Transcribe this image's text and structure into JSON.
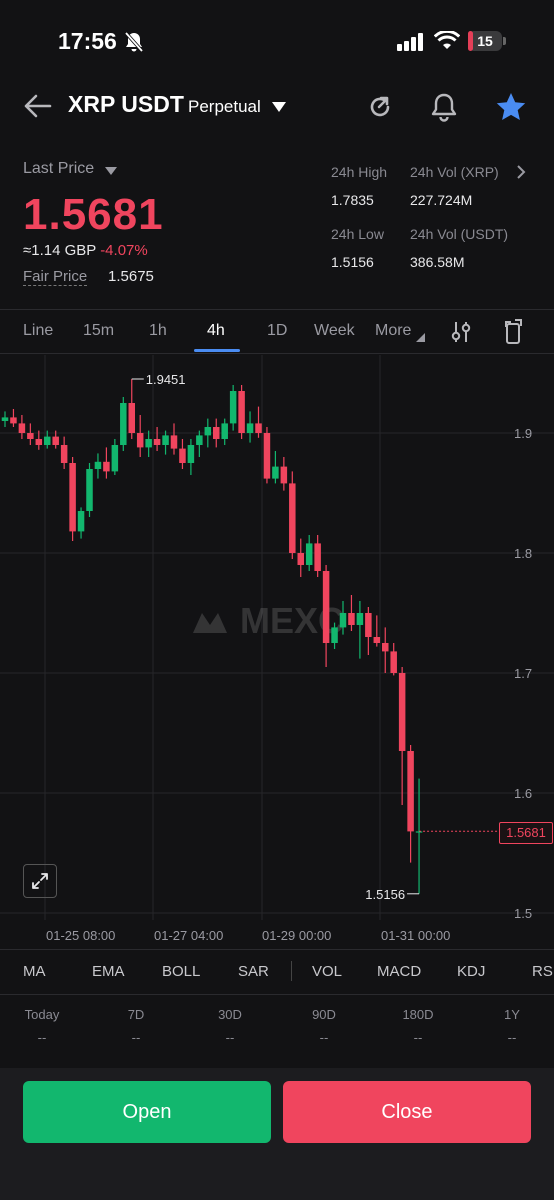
{
  "status": {
    "time": "17:56",
    "battery": "15",
    "battery_level": 0.15
  },
  "header": {
    "symbol": "XRP USDT",
    "contract": "Perpetual"
  },
  "price": {
    "last_price_label": "Last Price",
    "last_price": "1.5681",
    "conversion": "≈1.14 GBP",
    "change": "-4.07%",
    "fair_price_label": "Fair Price",
    "fair_price": "1.5675"
  },
  "stats": {
    "high_label": "24h High",
    "high": "1.7835",
    "vol_xrp_label": "24h Vol (XRP)",
    "vol_xrp": "227.724M",
    "low_label": "24h Low",
    "low": "1.5156",
    "vol_usdt_label": "24h Vol  (USDT)",
    "vol_usdt": "386.58M"
  },
  "tabs": [
    "Line",
    "15m",
    "1h",
    "4h",
    "1D",
    "Week",
    "More"
  ],
  "active_tab": "4h",
  "chart_data": {
    "type": "candlestick",
    "interval": "4h",
    "ylim": [
      1.5,
      1.95
    ],
    "y_ticks": [
      "1.9",
      "1.8",
      "1.7",
      "1.6",
      "1.5"
    ],
    "x_ticks": [
      "01-25 08:00",
      "01-27 04:00",
      "01-29 00:00",
      "01-31 00:00"
    ],
    "watermark": "MEXC",
    "max_label": "1.9451",
    "min_label": "1.5156",
    "last_price_tag": "1.5681",
    "up_color": "#12b76e",
    "down_color": "#f0455e",
    "candles": [
      [
        1.91,
        1.918,
        1.905,
        1.913
      ],
      [
        1.913,
        1.92,
        1.905,
        1.908
      ],
      [
        1.908,
        1.915,
        1.895,
        1.9
      ],
      [
        1.9,
        1.908,
        1.89,
        1.895
      ],
      [
        1.895,
        1.902,
        1.886,
        1.89
      ],
      [
        1.89,
        1.902,
        1.887,
        1.897
      ],
      [
        1.897,
        1.902,
        1.887,
        1.89
      ],
      [
        1.89,
        1.897,
        1.87,
        1.875
      ],
      [
        1.875,
        1.88,
        1.81,
        1.818
      ],
      [
        1.818,
        1.838,
        1.812,
        1.835
      ],
      [
        1.835,
        1.875,
        1.83,
        1.87
      ],
      [
        1.87,
        1.883,
        1.862,
        1.876
      ],
      [
        1.876,
        1.888,
        1.862,
        1.868
      ],
      [
        1.868,
        1.895,
        1.865,
        1.89
      ],
      [
        1.89,
        1.93,
        1.885,
        1.925
      ],
      [
        1.925,
        1.945,
        1.895,
        1.9
      ],
      [
        1.9,
        1.915,
        1.88,
        1.888
      ],
      [
        1.888,
        1.902,
        1.88,
        1.895
      ],
      [
        1.895,
        1.905,
        1.885,
        1.89
      ],
      [
        1.89,
        1.902,
        1.882,
        1.898
      ],
      [
        1.898,
        1.908,
        1.882,
        1.887
      ],
      [
        1.887,
        1.895,
        1.87,
        1.875
      ],
      [
        1.875,
        1.895,
        1.865,
        1.89
      ],
      [
        1.89,
        1.902,
        1.88,
        1.898
      ],
      [
        1.898,
        1.912,
        1.888,
        1.905
      ],
      [
        1.905,
        1.912,
        1.888,
        1.895
      ],
      [
        1.895,
        1.912,
        1.89,
        1.908
      ],
      [
        1.908,
        1.94,
        1.902,
        1.935
      ],
      [
        1.935,
        1.94,
        1.895,
        1.9
      ],
      [
        1.9,
        1.918,
        1.892,
        1.908
      ],
      [
        1.908,
        1.922,
        1.896,
        1.9
      ],
      [
        1.9,
        1.905,
        1.858,
        1.862
      ],
      [
        1.862,
        1.885,
        1.858,
        1.872
      ],
      [
        1.872,
        1.88,
        1.852,
        1.858
      ],
      [
        1.858,
        1.868,
        1.795,
        1.8
      ],
      [
        1.8,
        1.812,
        1.78,
        1.79
      ],
      [
        1.79,
        1.815,
        1.785,
        1.808
      ],
      [
        1.808,
        1.815,
        1.78,
        1.785
      ],
      [
        1.785,
        1.79,
        1.705,
        1.725
      ],
      [
        1.725,
        1.742,
        1.72,
        1.738
      ],
      [
        1.738,
        1.76,
        1.732,
        1.75
      ],
      [
        1.75,
        1.765,
        1.735,
        1.74
      ],
      [
        1.74,
        1.76,
        1.712,
        1.75
      ],
      [
        1.75,
        1.755,
        1.715,
        1.73
      ],
      [
        1.73,
        1.748,
        1.722,
        1.725
      ],
      [
        1.725,
        1.738,
        1.7,
        1.718
      ],
      [
        1.718,
        1.725,
        1.698,
        1.7
      ],
      [
        1.7,
        1.705,
        1.59,
        1.635
      ],
      [
        1.635,
        1.64,
        1.542,
        1.568
      ],
      [
        1.568,
        1.612,
        1.516,
        1.568
      ]
    ]
  },
  "indicators": [
    "MA",
    "EMA",
    "BOLL",
    "SAR",
    "VOL",
    "MACD",
    "KDJ",
    "RS"
  ],
  "periods": [
    {
      "label": "Today",
      "value": "--"
    },
    {
      "label": "7D",
      "value": "--"
    },
    {
      "label": "30D",
      "value": "--"
    },
    {
      "label": "90D",
      "value": "--"
    },
    {
      "label": "180D",
      "value": "--"
    },
    {
      "label": "1Y",
      "value": "--"
    }
  ],
  "actions": {
    "open": "Open",
    "close": "Close"
  },
  "colors": {
    "accent": "#4a8cf2",
    "up": "#12b76e",
    "down": "#f0455e"
  }
}
